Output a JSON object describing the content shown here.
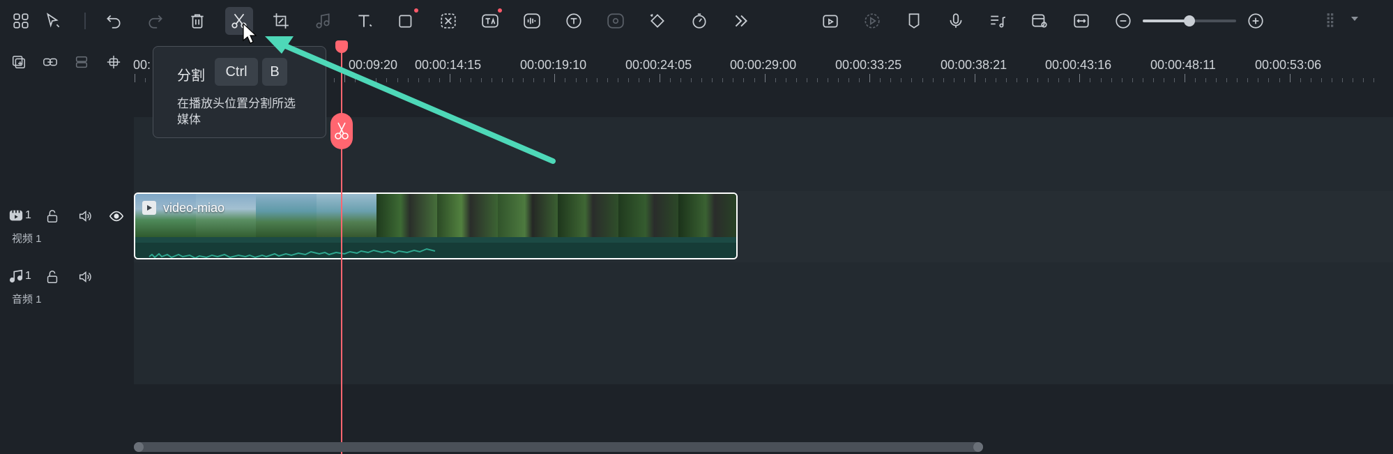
{
  "toolbar": {
    "zoom_level": 0.5,
    "items": [
      {
        "name": "layout-grid-icon"
      },
      {
        "name": "select-tool-icon"
      },
      {
        "name": "undo-icon"
      },
      {
        "name": "redo-icon"
      },
      {
        "name": "delete-icon"
      },
      {
        "name": "split-icon"
      },
      {
        "name": "crop-icon"
      },
      {
        "name": "audio-icon"
      },
      {
        "name": "text-icon"
      },
      {
        "name": "shape-icon"
      },
      {
        "name": "ai-remove-icon"
      },
      {
        "name": "ai-text-icon"
      },
      {
        "name": "voice-icon"
      },
      {
        "name": "subtitle-icon"
      },
      {
        "name": "audio-stretch-icon"
      },
      {
        "name": "keyframe-icon"
      },
      {
        "name": "speed-icon"
      },
      {
        "name": "more-icon"
      },
      {
        "name": "render-icon"
      },
      {
        "name": "preview-render-icon"
      },
      {
        "name": "marker-icon"
      },
      {
        "name": "microphone-icon"
      },
      {
        "name": "music-list-icon"
      },
      {
        "name": "preview-icon"
      },
      {
        "name": "fit-width-icon"
      },
      {
        "name": "zoom-out-icon"
      },
      {
        "name": "zoom-in-icon"
      },
      {
        "name": "layout-menu-icon"
      }
    ]
  },
  "tooltip": {
    "title": "分割",
    "key1": "Ctrl",
    "key2": "B",
    "description_line1": "在播放头位置分割所选",
    "description_line2": "媒体"
  },
  "ruler": {
    "labels": [
      "00:",
      "00:09:20",
      "00:00:14:15",
      "00:00:19:10",
      "00:00:24:05",
      "00:00:29:00",
      "00:00:33:25",
      "00:00:38:21",
      "00:00:43:16",
      "00:00:48:11",
      "00:00:53:06"
    ]
  },
  "tracks": {
    "video": {
      "count_badge": "1",
      "label": "视频 1"
    },
    "audio": {
      "count_badge": "1",
      "label": "音频 1"
    }
  },
  "clip": {
    "name": "video-miao"
  },
  "colors": {
    "accent": "#4ed8b8",
    "playhead": "#ff6670",
    "clip_border": "#ffffff"
  }
}
